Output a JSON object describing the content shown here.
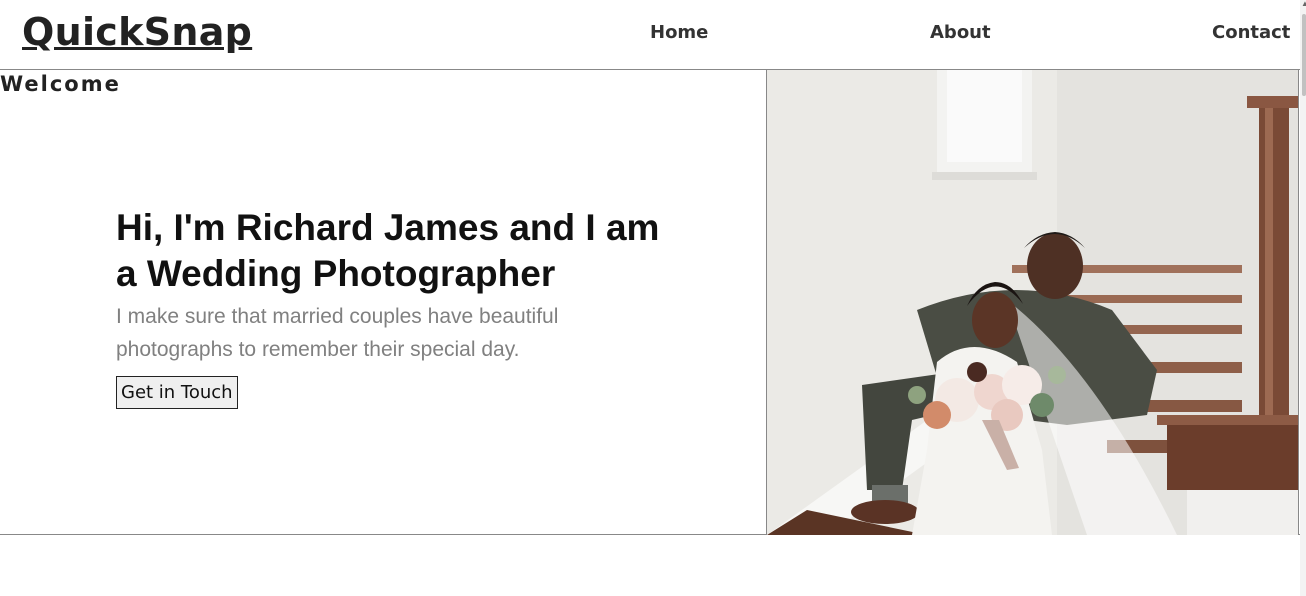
{
  "header": {
    "brand": "QuickSnap",
    "nav": [
      {
        "label": "Home"
      },
      {
        "label": "About"
      },
      {
        "label": "Contact"
      }
    ]
  },
  "hero": {
    "section_label": "Welcome",
    "headline": "Hi, I'm Richard James and I am a Wedding Photographer",
    "tagline": "I make sure that married couples have beautiful photographs to remember their special day.",
    "cta_label": "Get in Touch",
    "photo": "wedding-couple-on-stairs"
  }
}
